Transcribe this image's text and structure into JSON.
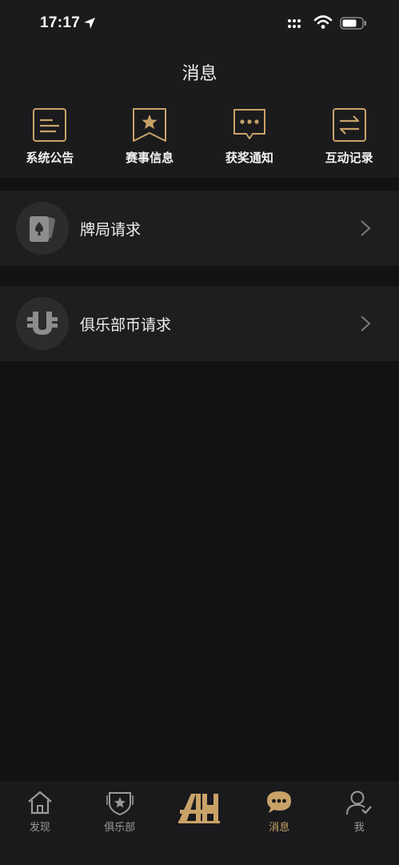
{
  "status_bar": {
    "time": "17:17"
  },
  "header": {
    "title": "消息"
  },
  "categories": [
    {
      "label": "系统公告",
      "icon": "announcement-icon"
    },
    {
      "label": "赛事信息",
      "icon": "event-bookmark-icon"
    },
    {
      "label": "获奖通知",
      "icon": "chat-bubble-icon"
    },
    {
      "label": "互动记录",
      "icon": "exchange-arrows-icon"
    }
  ],
  "requests": [
    {
      "label": "牌局请求",
      "icon": "playing-card-icon"
    },
    {
      "label": "俱乐部币请求",
      "icon": "club-coin-icon"
    }
  ],
  "tab_bar": {
    "items": [
      {
        "label": "发现",
        "icon": "home-icon"
      },
      {
        "label": "俱乐部",
        "icon": "club-shield-icon"
      },
      {
        "label": "",
        "icon": "brand-logo-icon"
      },
      {
        "label": "消息",
        "icon": "message-icon",
        "active": true
      },
      {
        "label": "我",
        "icon": "user-icon"
      }
    ]
  },
  "colors": {
    "accent": "#c9a268",
    "background": "#121212",
    "panel": "#1b1b1d",
    "row": "#1e1e20"
  }
}
